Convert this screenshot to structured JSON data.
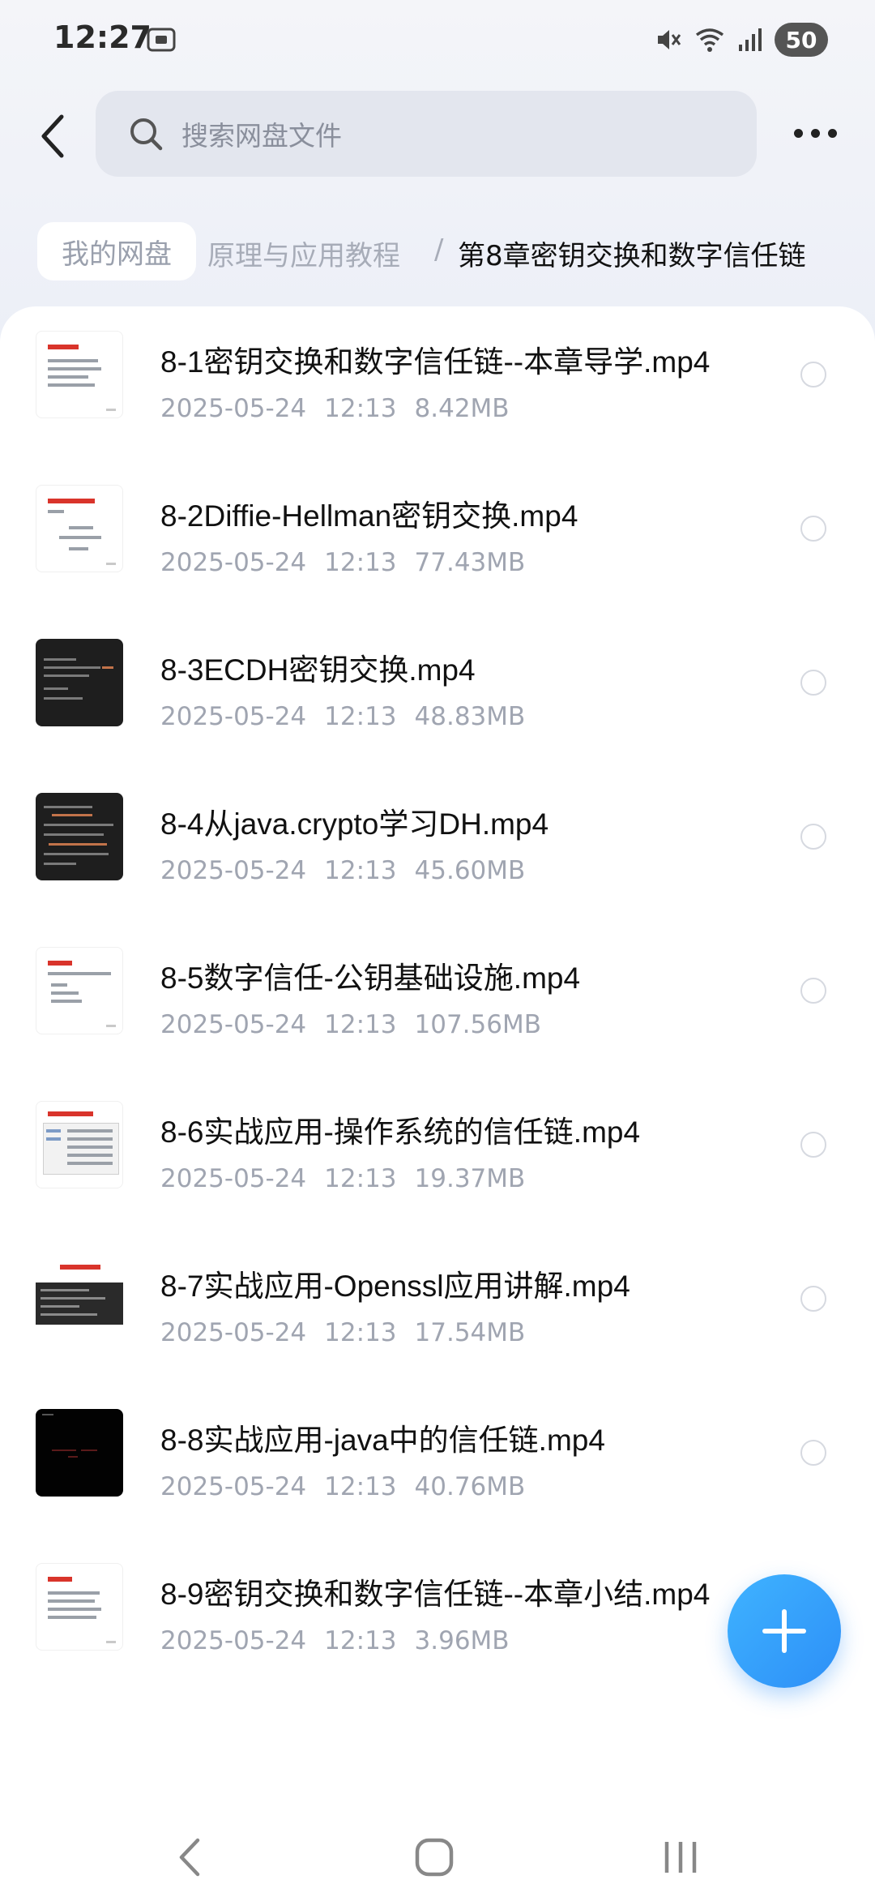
{
  "status_bar": {
    "time": "12:27",
    "battery": "50"
  },
  "header": {
    "search_placeholder": "搜索网盘文件"
  },
  "breadcrumb": {
    "root": "我的网盘",
    "middle": "原理与应用教程",
    "separator": "/",
    "current": "第8章密钥交换和数字信任链"
  },
  "files": [
    {
      "name": "8-1密钥交换和数字信任链--本章导学.mp4",
      "date": "2025-05-24",
      "time": "12:13",
      "size": "8.42MB",
      "thumbnail": "slide"
    },
    {
      "name": "8-2Diffie-Hellman密钥交换.mp4",
      "date": "2025-05-24",
      "time": "12:13",
      "size": "77.43MB",
      "thumbnail": "slide"
    },
    {
      "name": "8-3ECDH密钥交换.mp4",
      "date": "2025-05-24",
      "time": "12:13",
      "size": "48.83MB",
      "thumbnail": "code"
    },
    {
      "name": "8-4从java.crypto学习DH.mp4",
      "date": "2025-05-24",
      "time": "12:13",
      "size": "45.60MB",
      "thumbnail": "code"
    },
    {
      "name": "8-5数字信任-公钥基础设施.mp4",
      "date": "2025-05-24",
      "time": "12:13",
      "size": "107.56MB",
      "thumbnail": "slide"
    },
    {
      "name": "8-6实战应用-操作系统的信任链.mp4",
      "date": "2025-05-24",
      "time": "12:13",
      "size": "19.37MB",
      "thumbnail": "screenshot"
    },
    {
      "name": "8-7实战应用-Openssl应用讲解.mp4",
      "date": "2025-05-24",
      "time": "12:13",
      "size": "17.54MB",
      "thumbnail": "terminal"
    },
    {
      "name": "8-8实战应用-java中的信任链.mp4",
      "date": "2025-05-24",
      "time": "12:13",
      "size": "40.76MB",
      "thumbnail": "black"
    },
    {
      "name": "8-9密钥交换和数字信任链--本章小结.mp4",
      "date": "2025-05-24",
      "time": "12:13",
      "size": "3.96MB",
      "thumbnail": "slide"
    }
  ],
  "icons": {
    "back": "chevron-left-icon",
    "search": "search-icon",
    "more": "more-dots-icon",
    "fab": "plus-icon",
    "nav": [
      "nav-back-icon",
      "nav-home-icon",
      "nav-recents-icon"
    ]
  },
  "colors": {
    "accent": "#2d8ff7",
    "muted_text": "#a0a5b1",
    "background": "#eef1f8"
  }
}
